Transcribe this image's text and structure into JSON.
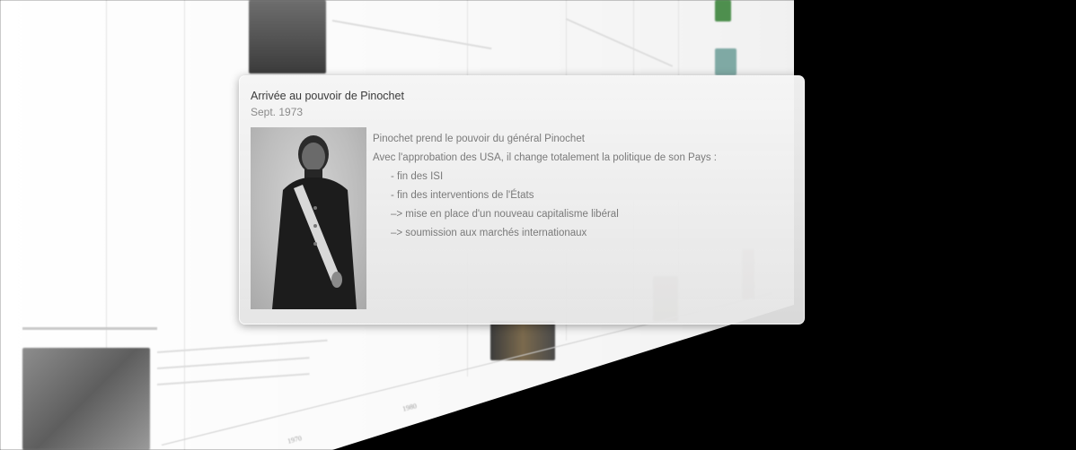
{
  "card": {
    "title": "Arrivée au pouvoir de Pinochet",
    "date": "Sept. 1973",
    "lines": [
      "Pinochet prend le pouvoir du général Pinochet",
      "Avec l'approbation des USA, il change totalement la politique de son Pays :"
    ],
    "bullets": [
      "- fin des ISI",
      "- fin des interventions de l'États",
      "–> mise en place d'un nouveau capitalisme libéral",
      "–> soumission aux marchés internationaux"
    ]
  },
  "timeline": {
    "axis_ticks": [
      "1970",
      "1980"
    ]
  },
  "icons": {
    "portrait": "pinochet-photo"
  }
}
